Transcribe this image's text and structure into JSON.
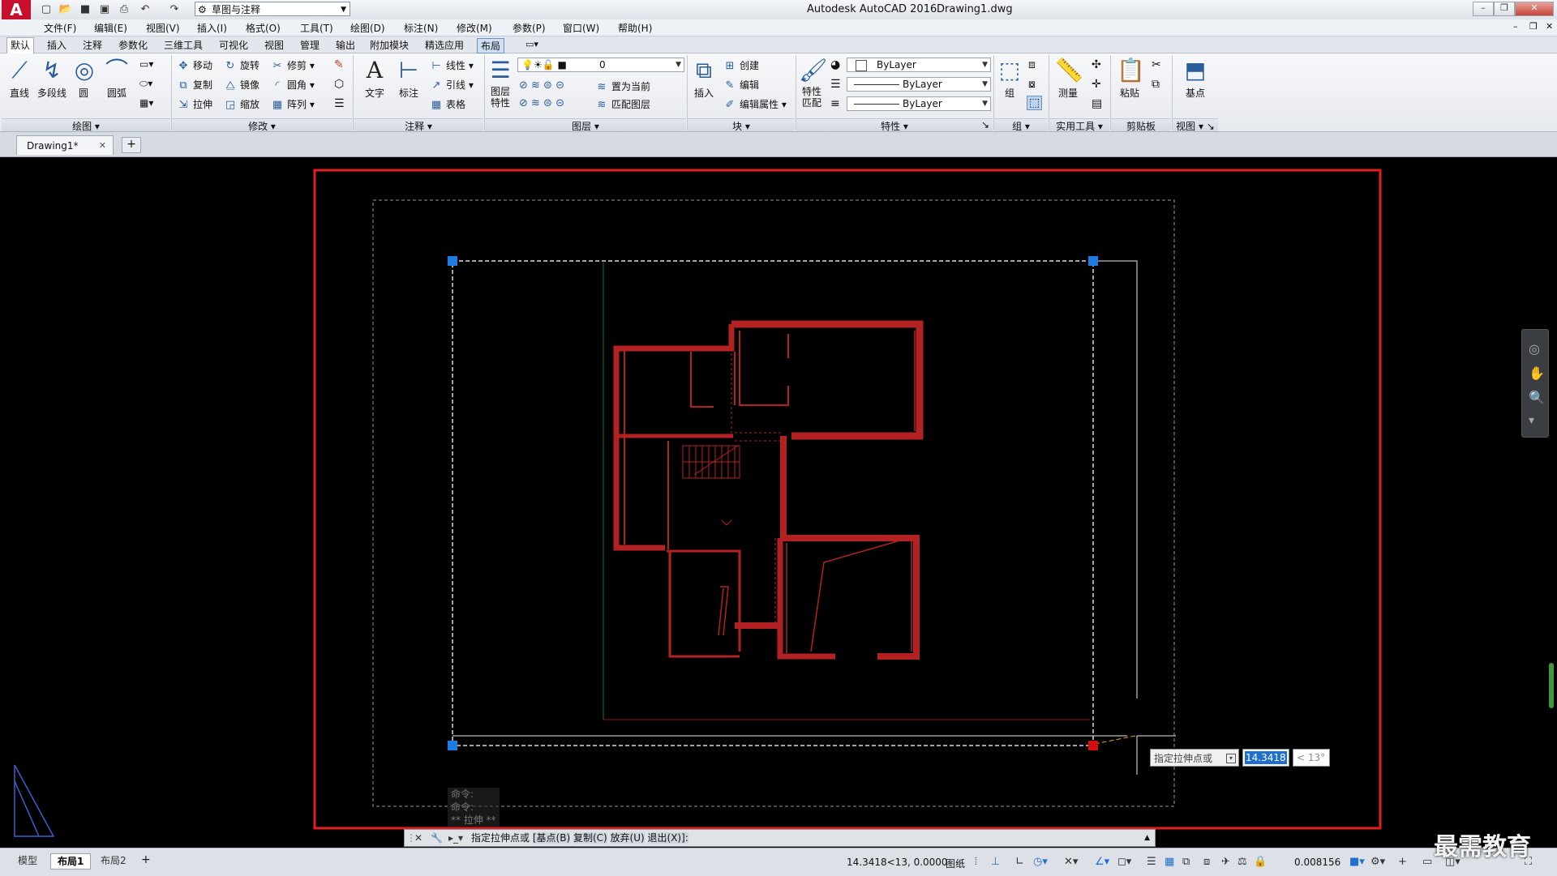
{
  "titlebar": {
    "app_title": "Autodesk AutoCAD 2016",
    "file_title": "Drawing1.dwg",
    "workspace": "草图与注释"
  },
  "menu": [
    "文件(F)",
    "编辑(E)",
    "视图(V)",
    "插入(I)",
    "格式(O)",
    "工具(T)",
    "绘图(D)",
    "标注(N)",
    "修改(M)",
    "参数(P)",
    "窗口(W)",
    "帮助(H)"
  ],
  "ribbon_tabs": [
    "默认",
    "插入",
    "注释",
    "参数化",
    "三维工具",
    "可视化",
    "视图",
    "管理",
    "输出",
    "附加模块",
    "精选应用",
    "布局"
  ],
  "ribbon": {
    "draw": {
      "line": "直线",
      "polyline": "多段线",
      "circle": "圆",
      "arc": "圆弧",
      "label": "绘图"
    },
    "modify": {
      "move": "移动",
      "rotate": "旋转",
      "trim": "修剪",
      "copy": "复制",
      "mirror": "镜像",
      "fillet": "圆角",
      "stretch": "拉伸",
      "scale": "缩放",
      "array": "阵列",
      "label": "修改"
    },
    "annotation": {
      "text": "文字",
      "dimension": "标注",
      "linear": "线性",
      "leader": "引线",
      "table": "表格",
      "label": "注释"
    },
    "layers": {
      "properties": "图层特性",
      "current_layer": "0",
      "set_current": "置为当前",
      "match_layer": "匹配图层",
      "label": "图层"
    },
    "block": {
      "insert": "插入",
      "create": "创建",
      "edit": "编辑",
      "edit_attr": "编辑属性",
      "label": "块"
    },
    "properties": {
      "match": "特性匹配",
      "color": "ByLayer",
      "linetype": "ByLayer",
      "lineweight": "ByLayer",
      "label": "特性"
    },
    "groups": {
      "group": "组",
      "label": "组"
    },
    "utilities": {
      "measure": "测量",
      "label": "实用工具"
    },
    "clipboard": {
      "paste": "粘贴",
      "label": "剪贴板"
    },
    "view": {
      "base": "基点",
      "label": "视图"
    }
  },
  "doc_tab": "Drawing1*",
  "prompt": {
    "label": "指定拉伸点或",
    "value": "14.3418",
    "angle": "< 13°"
  },
  "cmd_history": [
    "命令:",
    "命令:",
    "** 拉伸 **"
  ],
  "cmdline": {
    "text": "指定拉伸点或",
    "opt_base": "[基点(B)",
    "opt_copy": "复制(C)",
    "opt_undo": "放弃(U)",
    "opt_exit": "退出(X)]:"
  },
  "layout_tabs": [
    "模型",
    "布局1",
    "布局2"
  ],
  "status": {
    "coords": "14.3418<13, 0.0000",
    "space": "图纸",
    "scale": "0.008156"
  },
  "watermark": "最需教育",
  "colors": {
    "accent": "#d4202c",
    "grip": "#1e7be0",
    "grip_hot": "#d01010",
    "plan": "#b22222"
  }
}
